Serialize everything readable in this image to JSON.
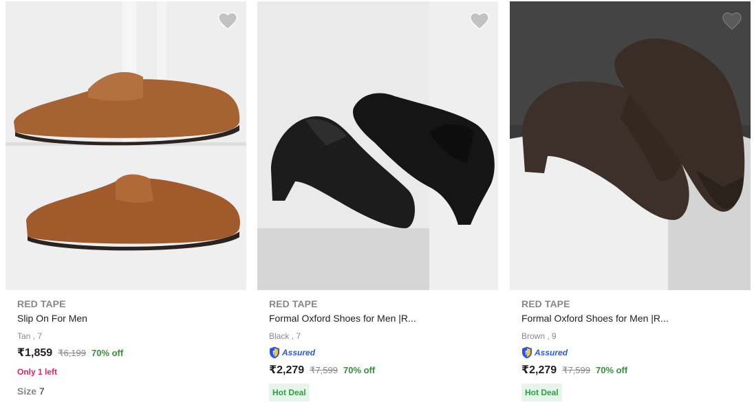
{
  "products": [
    {
      "brand": "RED TAPE",
      "title": "Slip On For Men",
      "variant": "Tan , 7",
      "price": "₹1,859",
      "mrp": "₹6,199",
      "discount": "70% off",
      "stock_note": "Only 1 left",
      "size_label": "Size",
      "size_value": "7",
      "image_icon": "tan-loafer-image"
    },
    {
      "brand": "RED TAPE",
      "title": "Formal Oxford Shoes for Men |R...",
      "variant": "Black , 7",
      "assured_label": "Assured",
      "price": "₹2,279",
      "mrp": "₹7,599",
      "discount": "70% off",
      "deal_badge": "Hot Deal",
      "image_icon": "black-oxford-image"
    },
    {
      "brand": "RED TAPE",
      "title": "Formal Oxford Shoes for Men |R...",
      "variant": "Brown , 9",
      "assured_label": "Assured",
      "price": "₹2,279",
      "mrp": "₹7,599",
      "discount": "70% off",
      "deal_badge": "Hot Deal",
      "image_icon": "brown-oxford-image"
    }
  ],
  "colors": {
    "price_green": "#388e3c",
    "stock_pink": "#e91e63",
    "assured_blue": "#2a55e5",
    "deal_bg": "#e6f4ea"
  }
}
